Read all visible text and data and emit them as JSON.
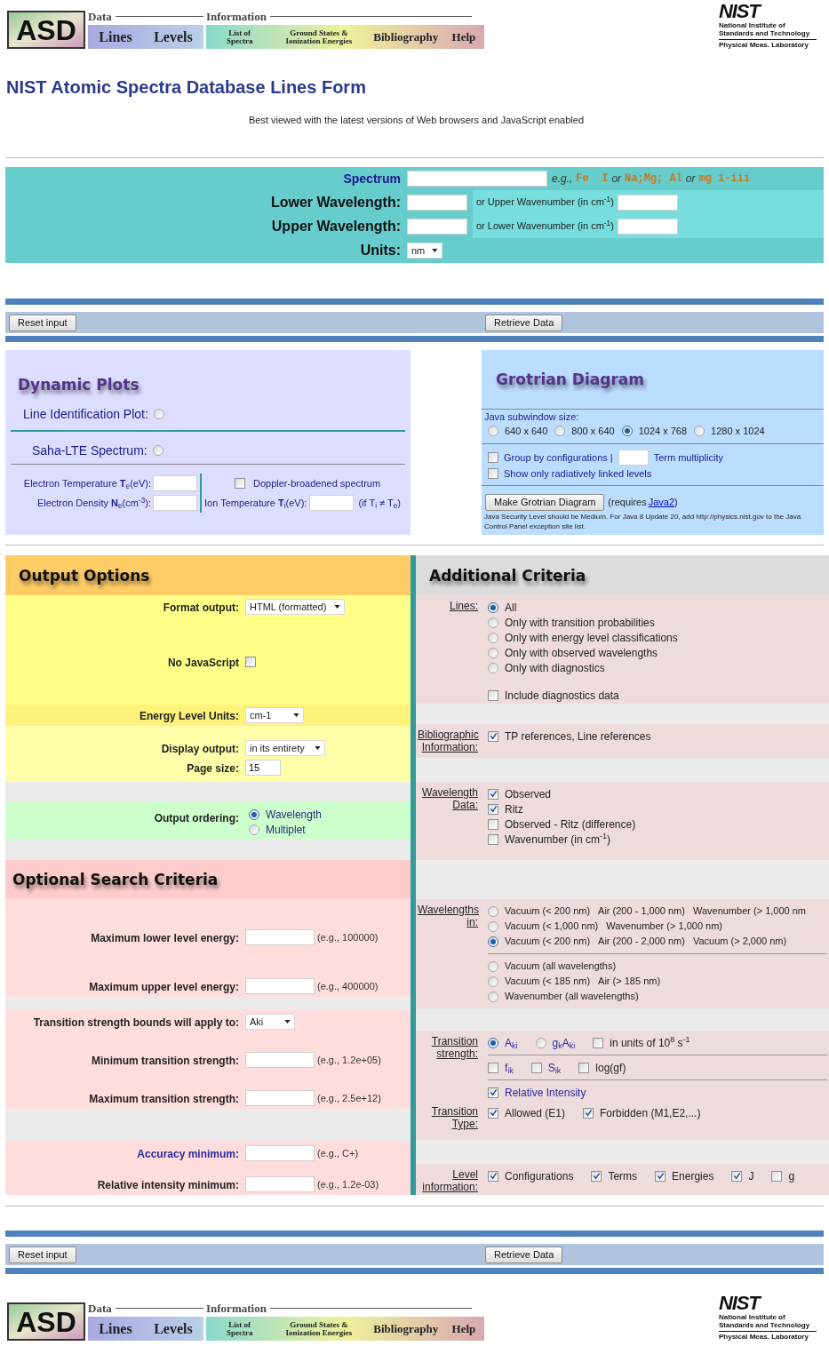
{
  "header": {
    "logo": "ASD",
    "data_label": "Data",
    "data_links": [
      "Lines",
      "Levels"
    ],
    "info_label": "Information",
    "info_links": [
      {
        "kind": "small",
        "text": "List of Spectra"
      },
      {
        "kind": "small",
        "text": "Ground States & Ionization Energies"
      },
      {
        "kind": "big",
        "text": "Bibliography"
      },
      {
        "kind": "big",
        "text": "Help"
      }
    ],
    "nist": {
      "mark": "NIST",
      "name": "National Institute of Standards and Technology",
      "lab": "Physical Meas. Laboratory"
    }
  },
  "title": "NIST Atomic Spectra Database Lines Form",
  "subtitle": "Best viewed with the latest versions of Web browsers and JavaScript enabled",
  "spectrum_form": {
    "spectrum": {
      "label": "Spectrum",
      "example": [
        {
          "kind": "hint",
          "text": "e.g.,"
        },
        {
          "kind": "code",
          "text": "Fe  I"
        },
        {
          "kind": "hint",
          "text": "or"
        },
        {
          "kind": "code",
          "text": "Na;Mg; Al"
        },
        {
          "kind": "hint",
          "text": "or"
        },
        {
          "kind": "code",
          "text": "mg i-iii"
        }
      ]
    },
    "lower": {
      "label": "Lower Wavelength:",
      "alt_label": "or Upper Wavenumber (in cm$^{-1}$)"
    },
    "upper": {
      "label": "Upper Wavelength:",
      "alt_label": "or Lower Wavenumber (in cm$^{-1}$)"
    },
    "units": {
      "label": "Units:",
      "value": "nm"
    }
  },
  "action_bar_top": {
    "buttons": [
      "Reset input",
      "Retrieve Data"
    ]
  },
  "dynamic_plots": {
    "title": "Dynamic Plots",
    "options": [
      {
        "label": "Line Identification Plot:",
        "selected": false
      },
      {
        "label": "Saha-LTE Spectrum:",
        "selected": false
      }
    ],
    "electron_temperature": "Electron Temperature **T**$_{e}$(eV):",
    "electron_density": "Electron Density **N**$_{e}$(cm$^{-3}$):",
    "doppler": {
      "label": "Doppler-broadened spectrum",
      "checked": false
    },
    "ion_temperature": "Ion Temperature **T**$_{i}$(eV):",
    "ion_note": "(if T$_{i}$ ≠ T$_{e}$)"
  },
  "grotrian": {
    "title": "Grotrian Diagram",
    "size_label": "Java subwindow size:",
    "sizes": [
      {
        "label": "640 x 640",
        "selected": false
      },
      {
        "label": "800 x 640",
        "selected": false
      },
      {
        "label": "1024 x 768",
        "selected": true
      },
      {
        "label": "1280 x 1024",
        "selected": false
      }
    ],
    "group": {
      "label": "Group by configurations |",
      "checked": false
    },
    "term_label": "Term multiplicity",
    "radiative": {
      "label": "Show only radiatively linked levels",
      "checked": false
    },
    "button": "Make Grotrian Diagram",
    "requires": "(requires",
    "link": "Java2",
    "requires_end": ")",
    "note": "Java Security Level should be Medium. For Java 8 Update 20, add http://physics.nist.gov to the Java Control Panel exception site list."
  },
  "output_options": {
    "title": "Output Options",
    "format": {
      "label": "Format output:",
      "value": "HTML (formatted)"
    },
    "no_javascript": {
      "label": "No JavaScript",
      "checked": false
    },
    "energy_units": {
      "label": "Energy Level Units:",
      "value": "cm-1"
    },
    "display": {
      "label": "Display output:",
      "value": "in its entirety"
    },
    "page_size": {
      "label": "Page size:",
      "value": "15"
    },
    "ordering": {
      "label": "Output ordering:",
      "options": [
        {
          "label": "Wavelength",
          "selected": true
        },
        {
          "label": "Multiplet",
          "selected": false
        }
      ]
    }
  },
  "optional_search": {
    "title": "Optional Search Criteria",
    "fields": [
      {
        "kind": "input",
        "label": "Maximum lower level energy:",
        "example": "(e.g., 100000)",
        "link": false
      },
      {
        "kind": "input",
        "label": "Maximum upper level energy:",
        "example": "(e.g., 400000)",
        "link": false
      },
      {
        "kind": "select",
        "label": "Transition strength bounds will apply to:",
        "value": "Aki",
        "link": false
      },
      {
        "kind": "input",
        "label": "Minimum transition strength:",
        "example": "(e.g., 1.2e+05)",
        "link": false
      },
      {
        "kind": "input",
        "label": "Maximum transition strength:",
        "example": "(e.g., 2.5e+12)",
        "link": false
      },
      {
        "kind": "input",
        "label": "Accuracy minimum:",
        "example": "(e.g., C+)",
        "link": true
      },
      {
        "kind": "input",
        "label": "Relative intensity minimum:",
        "example": "(e.g., 1.2e-03)",
        "link": false
      }
    ]
  },
  "additional_criteria": {
    "title": "Additional Criteria",
    "blocks": [
      {
        "sections": [
          {
            "label": "Lines:",
            "rows": [
              {
                "kind": "options",
                "items": [
                  {
                    "kind": "radio",
                    "label": "All",
                    "selected": true
                  }
                ]
              },
              {
                "kind": "options",
                "items": [
                  {
                    "kind": "radio",
                    "label": "Only with transition probabilities",
                    "selected": false
                  }
                ]
              },
              {
                "kind": "options",
                "items": [
                  {
                    "kind": "radio",
                    "label": "Only with energy level classifications",
                    "selected": false
                  }
                ]
              },
              {
                "kind": "options",
                "items": [
                  {
                    "kind": "radio",
                    "label": "Only with observed wavelengths",
                    "selected": false
                  }
                ]
              },
              {
                "kind": "options",
                "items": [
                  {
                    "kind": "radio",
                    "label": "Only with diagnostics",
                    "selected": false
                  }
                ]
              },
              {
                "kind": "options",
                "items": [
                  {
                    "kind": "checkbox",
                    "label": "Include diagnostics data",
                    "checked": false
                  }
                ]
              }
            ]
          }
        ]
      },
      {
        "sections": [
          {
            "label": "Bibliographic Information:",
            "rows": [
              {
                "kind": "options",
                "items": [
                  {
                    "kind": "checkbox",
                    "label": "TP references, Line references",
                    "checked": true
                  }
                ]
              }
            ]
          }
        ]
      },
      {
        "sections": [
          {
            "label": "Wavelength Data:",
            "rows": [
              {
                "kind": "options",
                "items": [
                  {
                    "kind": "checkbox",
                    "label": "Observed",
                    "checked": true
                  }
                ]
              },
              {
                "kind": "options",
                "items": [
                  {
                    "kind": "checkbox",
                    "label": "Ritz",
                    "checked": true
                  }
                ]
              },
              {
                "kind": "options",
                "items": [
                  {
                    "kind": "checkbox",
                    "label": "Observed - Ritz (difference)",
                    "checked": false
                  }
                ]
              },
              {
                "kind": "options",
                "items": [
                  {
                    "kind": "checkbox",
                    "label": "Wavenumber (in cm$^{-1}$)",
                    "checked": false
                  }
                ]
              }
            ]
          }
        ]
      },
      {
        "sections": [
          {
            "label": "Wavelengths in:",
            "rows": [
              {
                "kind": "options",
                "items": [
                  {
                    "kind": "radio",
                    "parts": [
                      "Vacuum (< 200 nm)",
                      "Air (200 - 1,000 nm)",
                      "Wavenumber (> 1,000 nm"
                    ],
                    "selected": false
                  }
                ]
              },
              {
                "kind": "options",
                "items": [
                  {
                    "kind": "radio",
                    "parts": [
                      "Vacuum (< 1,000 nm)",
                      "Wavenumber (> 1,000 nm)"
                    ],
                    "selected": false
                  }
                ]
              },
              {
                "kind": "options",
                "items": [
                  {
                    "kind": "radio",
                    "parts": [
                      "Vacuum (< 200 nm)",
                      "Air (200 - 2,000 nm)",
                      "Vacuum (> 2,000 nm)"
                    ],
                    "selected": true
                  }
                ]
              },
              {
                "kind": "rule"
              },
              {
                "kind": "options",
                "items": [
                  {
                    "kind": "radio",
                    "parts": [
                      "Vacuum (all wavelengths)"
                    ],
                    "selected": false
                  }
                ]
              },
              {
                "kind": "options",
                "items": [
                  {
                    "kind": "radio",
                    "parts": [
                      "Vacuum (< 185 nm)",
                      "Air (> 185 nm)"
                    ],
                    "selected": false
                  }
                ]
              },
              {
                "kind": "options",
                "items": [
                  {
                    "kind": "radio",
                    "parts": [
                      "Wavenumber (all wavelengths)"
                    ],
                    "selected": false
                  }
                ]
              }
            ]
          }
        ]
      },
      {
        "sections": [
          {
            "label": "Transition strength:",
            "rows": [
              {
                "kind": "options",
                "items": [
                  {
                    "kind": "radio",
                    "label": "A$_{ki}$",
                    "selected": true,
                    "link": true
                  },
                  {
                    "kind": "radio",
                    "label": "g$_{k}$A$_{ki}$",
                    "selected": false,
                    "link": true
                  },
                  {
                    "kind": "checkbox",
                    "label": "in units of 10$^{8}$ s$^{-1}$",
                    "checked": false
                  }
                ]
              },
              {
                "kind": "rule"
              },
              {
                "kind": "options",
                "items": [
                  {
                    "kind": "checkbox",
                    "label": "f$_{ik}$",
                    "checked": false,
                    "link": true
                  },
                  {
                    "kind": "checkbox",
                    "label": "S$_{ik}$",
                    "checked": false,
                    "link": true
                  },
                  {
                    "kind": "checkbox",
                    "label": "log(gf)",
                    "checked": false
                  }
                ]
              },
              {
                "kind": "rule"
              },
              {
                "kind": "options",
                "items": [
                  {
                    "kind": "checkbox",
                    "label": "Relative Intensity",
                    "checked": true,
                    "link": true
                  }
                ]
              }
            ]
          },
          {
            "label": "Transition Type:",
            "rows": [
              {
                "kind": "options",
                "items": [
                  {
                    "kind": "checkbox",
                    "label": "Allowed (E1)",
                    "checked": true
                  },
                  {
                    "kind": "checkbox",
                    "label": "Forbidden (M1,E2,...)",
                    "checked": true
                  }
                ]
              }
            ]
          }
        ]
      },
      {
        "sections": [
          {
            "label": "Level information:",
            "rows": [
              {
                "kind": "options",
                "items": [
                  {
                    "kind": "checkbox",
                    "label": "Configurations",
                    "checked": true
                  },
                  {
                    "kind": "checkbox",
                    "label": "Terms",
                    "checked": true
                  },
                  {
                    "kind": "checkbox",
                    "label": "Energies",
                    "checked": true
                  },
                  {
                    "kind": "checkbox",
                    "label": "J",
                    "checked": true
                  },
                  {
                    "kind": "checkbox",
                    "label": "g",
                    "checked": false
                  }
                ]
              }
            ]
          }
        ]
      }
    ]
  },
  "action_bar_bottom": {
    "buttons": [
      "Reset input",
      "Retrieve Data"
    ]
  },
  "footer": {
    "logo": "ASD",
    "data_label": "Data",
    "data_links": [
      "Lines",
      "Levels"
    ],
    "info_label": "Information",
    "info_links": [
      {
        "kind": "small",
        "text": "List of Spectra"
      },
      {
        "kind": "small",
        "text": "Ground States & Ionization Energies"
      },
      {
        "kind": "big",
        "text": "Bibliography"
      },
      {
        "kind": "big",
        "text": "Help"
      }
    ],
    "nist": {
      "mark": "NIST",
      "name": "National Institute of Standards and Technology",
      "lab": "Physical Meas. Laboratory"
    }
  }
}
